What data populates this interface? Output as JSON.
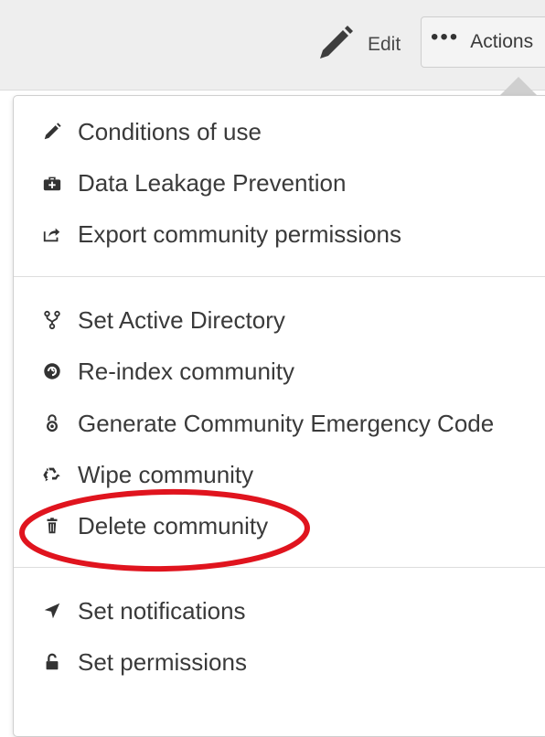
{
  "toolbar": {
    "edit_label": "Edit",
    "actions_label": "Actions",
    "dots": "•••"
  },
  "menu": {
    "groups": [
      {
        "items": [
          {
            "label": "Conditions of use",
            "icon": "pencil-icon"
          },
          {
            "label": "Data Leakage Prevention",
            "icon": "medkit-icon"
          },
          {
            "label": "Export community permissions",
            "icon": "export-icon"
          }
        ]
      },
      {
        "items": [
          {
            "label": "Set Active Directory",
            "icon": "fork-icon"
          },
          {
            "label": "Re-index community",
            "icon": "reindex-icon"
          },
          {
            "label": "Generate Community Emergency Code",
            "icon": "lock-badge-icon"
          },
          {
            "label": "Wipe community",
            "icon": "recycle-icon"
          },
          {
            "label": "Delete community",
            "icon": "trash-icon"
          }
        ]
      },
      {
        "items": [
          {
            "label": "Set notifications",
            "icon": "location-arrow-icon"
          },
          {
            "label": "Set permissions",
            "icon": "unlock-icon"
          }
        ]
      }
    ]
  },
  "colors": {
    "highlight": "#e0141e",
    "text": "#3a3a3a",
    "toolbar_bg": "#eeeeee"
  }
}
